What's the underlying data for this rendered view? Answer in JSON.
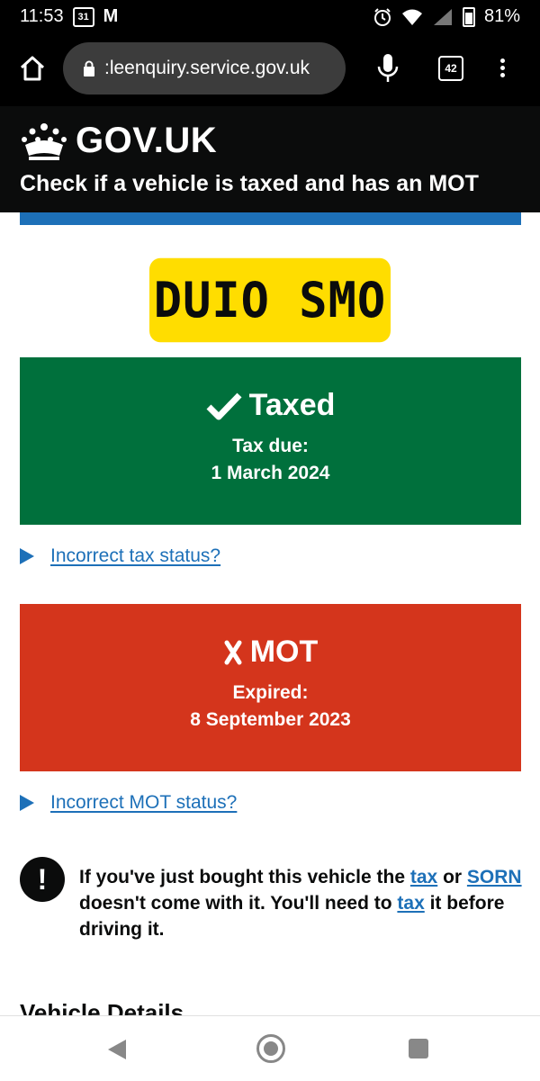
{
  "status_bar": {
    "time": "11:53",
    "calendar_day": "31",
    "gmail_glyph": "M",
    "battery": "81%",
    "icons": [
      "alarm-icon",
      "wifi-icon",
      "signal-icon",
      "battery-icon"
    ]
  },
  "browser": {
    "url": ":leenquiry.service.gov.uk",
    "tab_count": "42"
  },
  "header": {
    "logo_text": "GOV.UK",
    "service_name": "Check if a vehicle is taxed and has an MOT"
  },
  "vehicle": {
    "registration": "DUIO SMO"
  },
  "tax": {
    "title": "Taxed",
    "label": "Tax due:",
    "date": "1 March 2024",
    "details_link": "Incorrect tax status?",
    "color": "#00703c"
  },
  "mot": {
    "title": "MOT",
    "label": "Expired:",
    "date": "8 September 2023",
    "details_link": "Incorrect MOT status?",
    "color": "#d4351c"
  },
  "warning": {
    "icon_glyph": "!",
    "part1": "If you've just bought this vehicle the ",
    "link1": "tax",
    "part2": " or ",
    "link2": "SORN",
    "part3": " doesn't come with it. You'll need to ",
    "link3": "tax",
    "part4": " it before driving it."
  },
  "section_heading": "Vehicle Details",
  "colors": {
    "link": "#1d70b8",
    "plate": "#ffdd00",
    "header": "#0b0c0c"
  }
}
